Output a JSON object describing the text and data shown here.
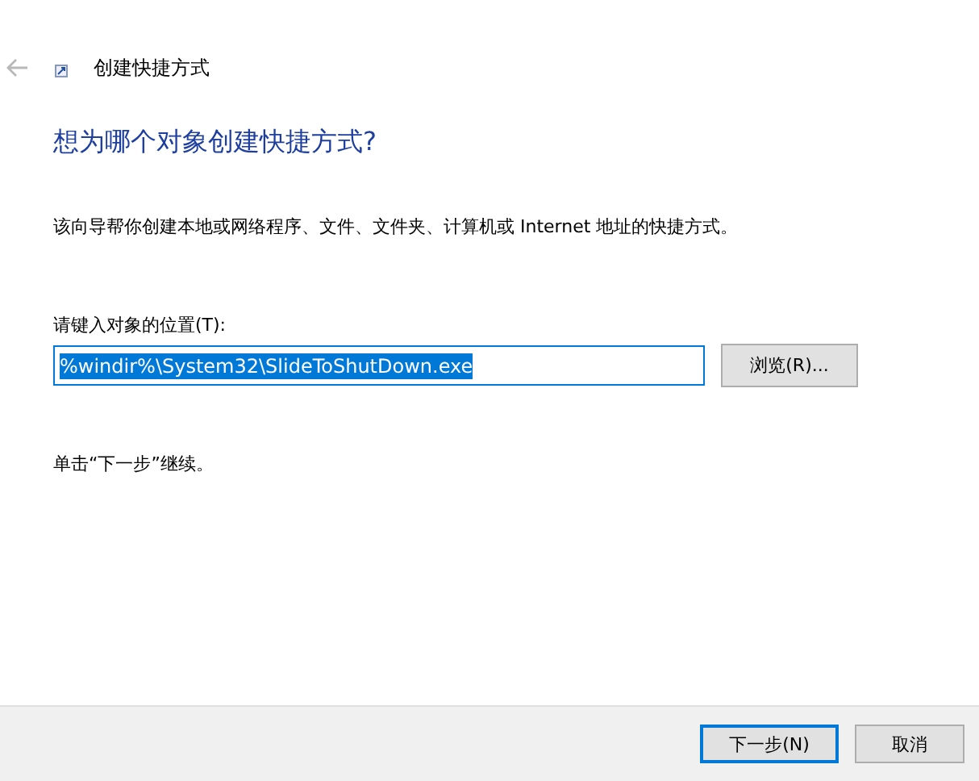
{
  "window": {
    "title": "创建快捷方式"
  },
  "heading": "想为哪个对象创建快捷方式?",
  "description": "该向导帮你创建本地或网络程序、文件、文件夹、计算机或 Internet 地址的快捷方式。",
  "location": {
    "label": "请键入对象的位置(T):",
    "value": "%windir%\\System32\\SlideToShutDown.exe",
    "browse_button": "浏览(R)..."
  },
  "hint": "单击“下一步”继续。",
  "buttons": [
    {
      "label": "下一步(N)",
      "kind": "default"
    },
    {
      "label": "取消",
      "kind": "normal"
    }
  ]
}
